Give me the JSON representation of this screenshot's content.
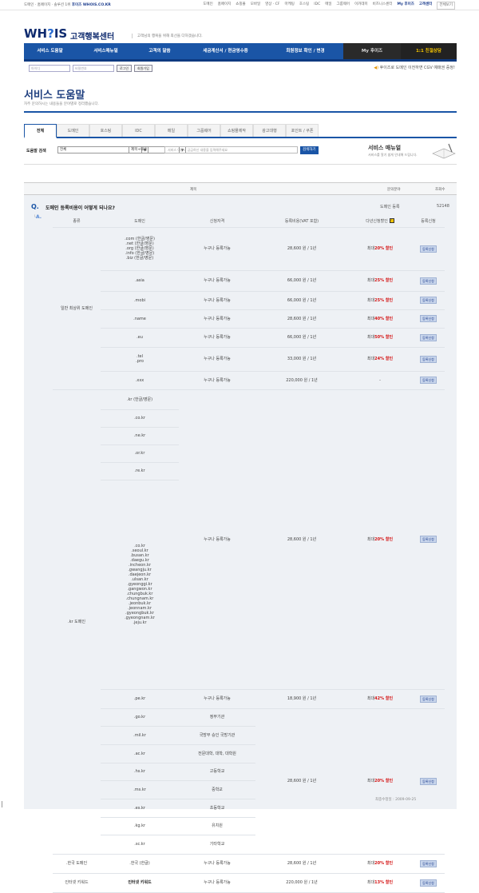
{
  "topbar": {
    "left": "도메인 · 홈페이지 · 솔루션 1위",
    "left_brand": "후이즈 WHOIS.CO.KR",
    "links": [
      "도메인",
      "홈페이지",
      "쇼핑몰",
      "모바일",
      "영상 · CF",
      "마케팅",
      "호스팅",
      "IDC",
      "메일",
      "그룹웨어",
      "이카데미",
      "비즈니스센터"
    ],
    "myhuiz": "My 후이즈",
    "cs": "고객센터",
    "family": "전체보기"
  },
  "logo": {
    "mark": "WH",
    "q": "?",
    "rest": "IS",
    "sub": "고객행복센터",
    "slogan": "고객님의 행복을 위해 최선을 다하겠습니다."
  },
  "gnb": [
    "서비스 도움말",
    "서비스매뉴얼",
    "고객의 말씀",
    "세금계산서 / 현금영수증",
    "회원정보 확인 / 변경",
    "My 후이즈",
    "1:1 친절상담"
  ],
  "login": {
    "id_ph": "아이디",
    "pw_ph": "비밀번호",
    "login": "로그인",
    "join": "회원가입"
  },
  "notice": "후이즈로 도메인 이전하면 CGV 예매권 증정!",
  "page": {
    "title": "서비스 도움말",
    "subtitle": "자주 문의하시는 내용들을 분야별로 정리했습니다."
  },
  "tabs": [
    "전체",
    "도메인",
    "호스팅",
    "IDC",
    "메일",
    "그룹웨어",
    "쇼핑몰제작",
    "광고대행",
    "포인트 / 쿠폰"
  ],
  "search": {
    "label": "도움말 검색",
    "cat": "전체",
    "scope": "제목+내용",
    "placeholder": "서비스 이용시 궁금하신 내용을 입력해주세요",
    "button": "검색하기",
    "manual": "서비스 매뉴얼",
    "manual_desc": "서비스를 알기 쉽게 안내해 드립니다."
  },
  "list_header": {
    "title": "제목",
    "category": "문의분야",
    "views": "조회수"
  },
  "question": {
    "mark": "Q.",
    "title": "도메인 등록비용이 어떻게 되나요?",
    "category": "도메인 등록",
    "views": "52148"
  },
  "answer_mark": "A.",
  "table": {
    "headers": [
      "종류",
      "도메인",
      "신청자격",
      "등록비용(VAT 포함)",
      "다년신청할인",
      "등록신청"
    ],
    "groups": [
      "일반 최상위 도메인",
      ".kr 도메인",
      ".한국 도메인",
      "인터넷 키워드"
    ],
    "domains": [
      ".com (한글/영문)\n.net (한글/영문)\n.org (한글/영문)\n.info (한글/영문)\n.biz (한글/영문)",
      ".asia",
      ".mobi",
      ".name",
      ".eu",
      ".tel\n.pro",
      ".xxx",
      ".kr (한글/영문)",
      ".co.kr",
      ".ne.kr",
      ".or.kr",
      ".re.kr",
      ".co.kr\n.seoul.kr\n.busan.kr\n.daegu.kr\n.incheon.kr\n.gwangju.kr\n.daejeon.kr\n.ulsan.kr\n.gyeonggi.kr\n.gangwon.kr\n.chungbuk.kr\n.chungnam.kr\n.jeonbuk.kr\n.jeonnam.kr\n.gyeongbuk.kr\n.gyeongnam.kr\n.jeju.kr",
      ".pe.kr",
      ".go.kr",
      ".mil.kr",
      ".ac.kr",
      ".hs.kr",
      ".ms.kr",
      ".es.kr",
      ".kg.kr",
      ".sc.kr",
      ".한국 (한글)",
      "인터넷 키워드"
    ],
    "quals": [
      "누구나 등록가능",
      "누구나 등록가능",
      "누구나 등록가능",
      "누구나 등록가능",
      "누구나 등록가능",
      "누구나 등록가능",
      "누구나 등록가능",
      "누구나 등록가능",
      "누구나 등록가능",
      "정부기관",
      "국방부 승인 국방기관",
      "전문대학, 대학, 대학원",
      "고등학교",
      "중학교",
      "초등학교",
      "유치원",
      "기타학교",
      "누구나 등록가능",
      "누구나 등록가능"
    ],
    "prices": [
      "28,600 원 / 1년",
      "66,000 원 / 1년",
      "66,000 원 / 1년",
      "28,600 원 / 1년",
      "66,000 원 / 1년",
      "33,000 원 / 1년",
      "220,000 원 / 1년",
      "28,600 원 / 1년",
      "18,900 원 / 1년",
      "28,600 원 / 1년",
      "28,600 원 / 1년",
      "220,000 원 / 1년"
    ],
    "discount_prefix": "최대",
    "discounts": [
      "20% 할인",
      "25% 할인",
      "25% 할인",
      "40% 할인",
      "50% 할인",
      "24% 할인",
      "-",
      "20% 할인",
      "42% 할인",
      "20% 할인",
      "20% 할인",
      "13% 할인"
    ],
    "register": "등록신청"
  },
  "footer": "최종수정일 : 2009-09-25"
}
